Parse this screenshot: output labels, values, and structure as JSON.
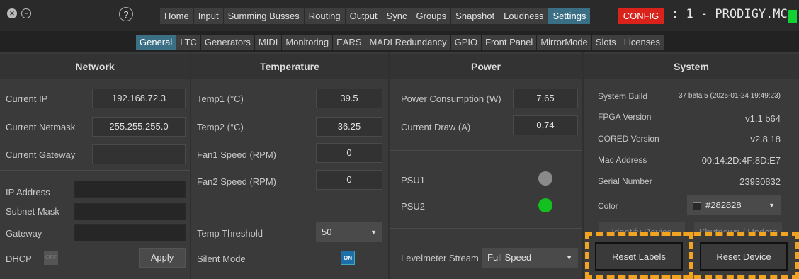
{
  "topbar": {
    "menu": [
      "Home",
      "Input",
      "Summing Busses",
      "Routing",
      "Output",
      "Sync",
      "Groups",
      "Snapshot",
      "Loudness",
      "Settings"
    ],
    "active_menu": "Settings",
    "help_label": "?",
    "config_label": "CONFIG",
    "device_title": ": 1 - PRODIGY.MC",
    "status_color": "#11d133"
  },
  "subtabs": {
    "items": [
      "General",
      "LTC",
      "Generators",
      "MIDI",
      "Monitoring",
      "EARS",
      "MADI Redundancy",
      "GPIO",
      "Front Panel",
      "MirrorMode",
      "Slots",
      "Licenses"
    ],
    "active": "General"
  },
  "network": {
    "title": "Network",
    "current_ip_label": "Current IP",
    "current_ip": "192.168.72.3",
    "current_netmask_label": "Current Netmask",
    "current_netmask": "255.255.255.0",
    "current_gateway_label": "Current Gateway",
    "current_gateway": "",
    "ip_address_label": "IP Address",
    "subnet_mask_label": "Subnet Mask",
    "gateway_label": "Gateway",
    "dhcp_label": "DHCP",
    "dhcp_state": "OFF",
    "apply_label": "Apply"
  },
  "temperature": {
    "title": "Temperature",
    "temp1_label": "Temp1 (°C)",
    "temp1": "39.5",
    "temp2_label": "Temp2 (°C)",
    "temp2": "36.25",
    "fan1_label": "Fan1 Speed (RPM)",
    "fan1": "0",
    "fan2_label": "Fan2 Speed (RPM)",
    "fan2": "0",
    "threshold_label": "Temp Threshold",
    "threshold": "50",
    "silent_label": "Silent Mode",
    "silent_state": "ON"
  },
  "power": {
    "title": "Power",
    "consumption_label": "Power Consumption (W)",
    "consumption": "7,65",
    "draw_label": "Current Draw (A)",
    "draw": "0,74",
    "psu1_label": "PSU1",
    "psu1_color": "#8a8a8a",
    "psu2_label": "PSU2",
    "psu2_color": "#13c01f",
    "levelmeter_label": "Levelmeter Stream",
    "levelmeter_value": "Full Speed"
  },
  "system": {
    "title": "System",
    "build_label": "System Build",
    "build": "37 beta 5 (2025-01-24 19:49:23)",
    "fpga_label": "FPGA Version",
    "fpga": "v1.1 b64",
    "cored_label": "CORED Version",
    "cored": "v2.8.18",
    "mac_label": "Mac Address",
    "mac": "00:14:2D:4F:8D:E7",
    "serial_label": "Serial Number",
    "serial": "23930832",
    "color_label": "Color",
    "color_value": "#282828",
    "identify_label": "Identify Device",
    "shutdown_label": "Shutdown / Update",
    "reset_labels_label": "Reset Labels",
    "reset_device_label": "Reset Device"
  }
}
